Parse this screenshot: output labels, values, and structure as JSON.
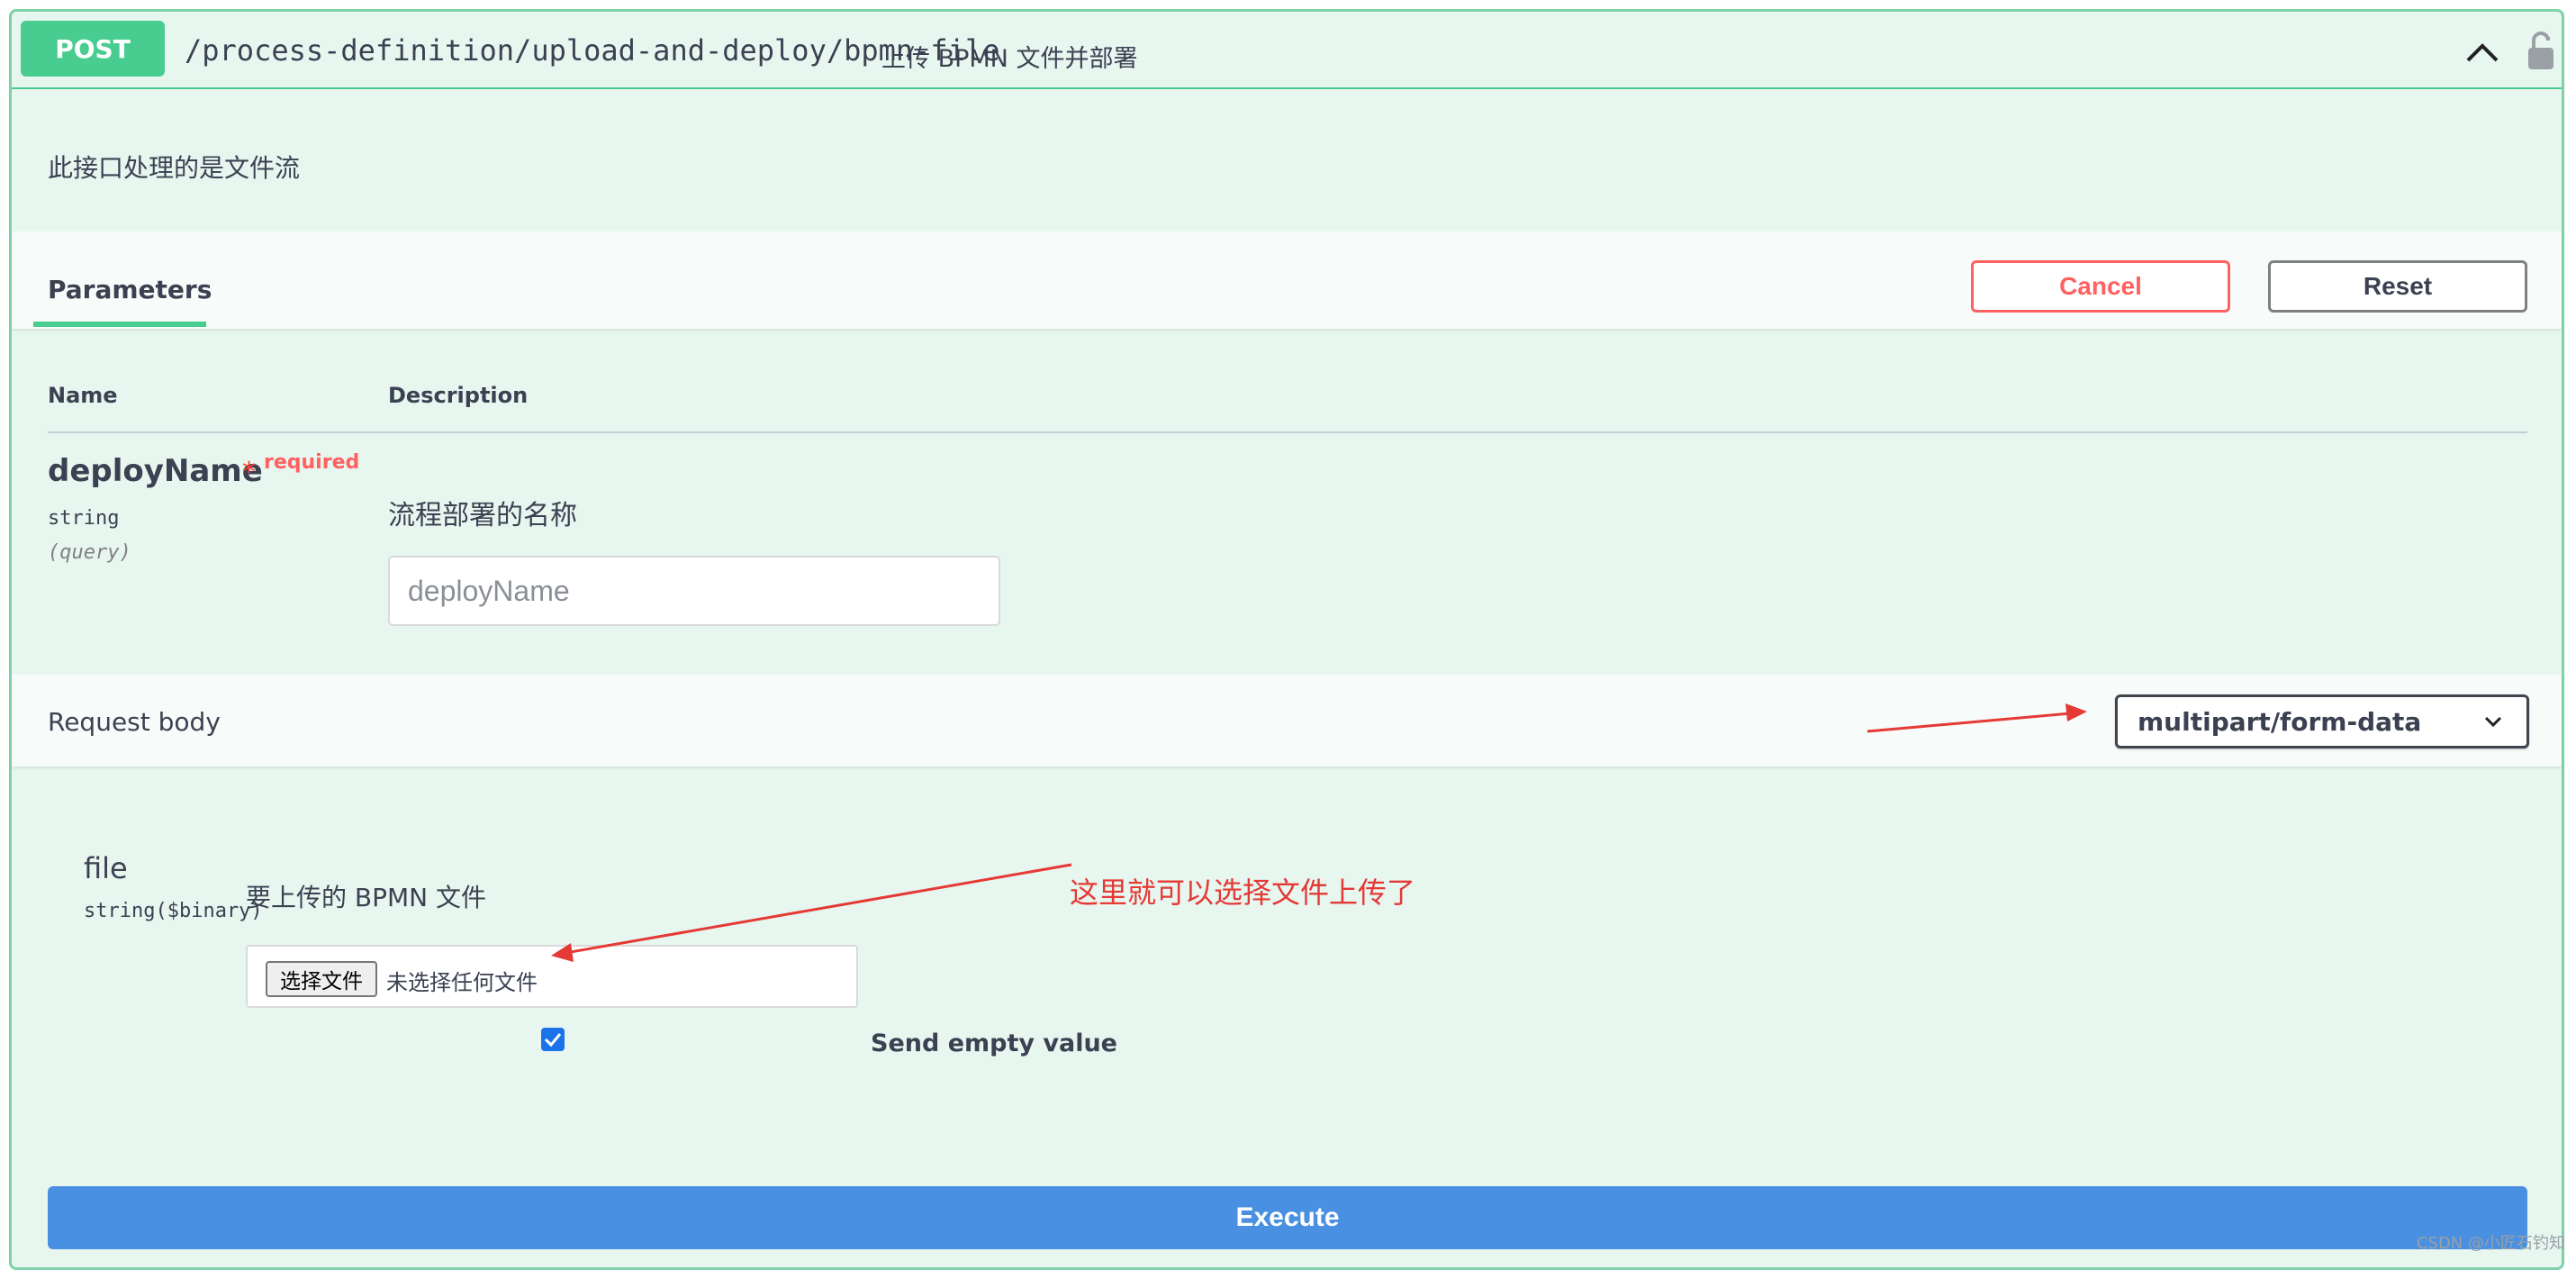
{
  "operation": {
    "method": "POST",
    "path": "/process-definition/upload-and-deploy/bpmn-file",
    "summary": "上传 BPMN 文件并部署",
    "description": "此接口处理的是文件流",
    "expanded": true,
    "locked": false
  },
  "parameters_section": {
    "tab_label": "Parameters",
    "cancel_label": "Cancel",
    "reset_label": "Reset",
    "col_name": "Name",
    "col_description": "Description"
  },
  "parameter": {
    "name": "deployName",
    "required_star": "*",
    "required_label": "required",
    "type": "string",
    "in": "(query)",
    "description": "流程部署的名称",
    "placeholder": "deployName",
    "value": ""
  },
  "request_body": {
    "title": "Request body",
    "content_type": "multipart/form-data",
    "file_field": {
      "name": "file",
      "type": "string($binary)",
      "description": "要上传的 BPMN 文件",
      "choose_button": "选择文件",
      "no_file_text": "未选择任何文件",
      "send_empty_checked": true,
      "send_empty_label": "Send empty value"
    }
  },
  "annotation": {
    "note_text": "这里就可以选择文件上传了",
    "arrow_color": "#e53935"
  },
  "execute_label": "Execute",
  "watermark": "CSDN @小匠石钓知",
  "colors": {
    "post_green": "#49cc90",
    "block_bg": "#e8f6f0",
    "cancel_red": "#ff6060",
    "execute_blue": "#4990e2"
  },
  "icons": {
    "collapse": "chevron-up-icon",
    "auth": "lock-icon",
    "select": "chevron-down-icon",
    "checkbox": "checkmark-icon"
  }
}
